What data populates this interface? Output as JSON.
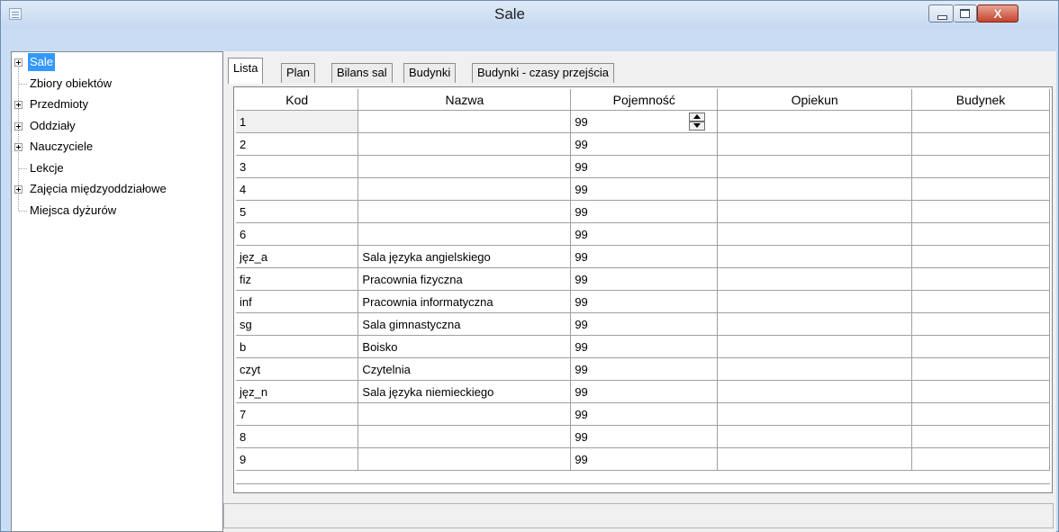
{
  "window": {
    "title": "Sale",
    "icon": "window-list-icon",
    "buttons": {
      "minimize": "minimize-icon",
      "maximize": "maximize-icon",
      "close": "X"
    }
  },
  "tree": {
    "items": [
      {
        "label": "Sale",
        "expandable": true,
        "selected": true
      },
      {
        "label": "Zbiory obiektów",
        "expandable": false
      },
      {
        "label": "Przedmioty",
        "expandable": true
      },
      {
        "label": "Oddziały",
        "expandable": true
      },
      {
        "label": "Nauczyciele",
        "expandable": true
      },
      {
        "label": "Lekcje",
        "expandable": false
      },
      {
        "label": "Zajęcia międzyoddziałowe",
        "expandable": true
      },
      {
        "label": "Miejsca dyżurów",
        "expandable": false
      }
    ]
  },
  "tabs": [
    {
      "label": "Lista",
      "active": true
    },
    {
      "label": "Plan"
    },
    {
      "label": "Bilans sal"
    },
    {
      "label": "Budynki"
    },
    {
      "label": "Budynki - czasy przejścia"
    }
  ],
  "table": {
    "columns": [
      "Kod",
      "Nazwa",
      "Pojemność",
      "Opiekun",
      "Budynek"
    ],
    "rows": [
      [
        "1",
        "",
        "99",
        "",
        ""
      ],
      [
        "2",
        "",
        "99",
        "",
        ""
      ],
      [
        "3",
        "",
        "99",
        "",
        ""
      ],
      [
        "4",
        "",
        "99",
        "",
        ""
      ],
      [
        "5",
        "",
        "99",
        "",
        ""
      ],
      [
        "6",
        "",
        "99",
        "",
        ""
      ],
      [
        "jęz_a",
        "Sala języka angielskiego",
        "99",
        "",
        ""
      ],
      [
        "fiz",
        "Pracownia fizyczna",
        "99",
        "",
        ""
      ],
      [
        "inf",
        "Pracownia informatyczna",
        "99",
        "",
        ""
      ],
      [
        "sg",
        "Sala gimnastyczna",
        "99",
        "",
        ""
      ],
      [
        "b",
        "Boisko",
        "99",
        "",
        ""
      ],
      [
        "czyt",
        "Czytelnia",
        "99",
        "",
        ""
      ],
      [
        "jęz_n",
        "Sala języka niemieckiego",
        "99",
        "",
        ""
      ],
      [
        "7",
        "",
        "99",
        "",
        ""
      ],
      [
        "8",
        "",
        "99",
        "",
        ""
      ],
      [
        "9",
        "",
        "99",
        "",
        ""
      ]
    ]
  },
  "statusbar": {
    "text": ""
  },
  "colors": {
    "selection": "#3399ff",
    "titlebar": "#c4d8f1",
    "close": "#c7432e"
  }
}
